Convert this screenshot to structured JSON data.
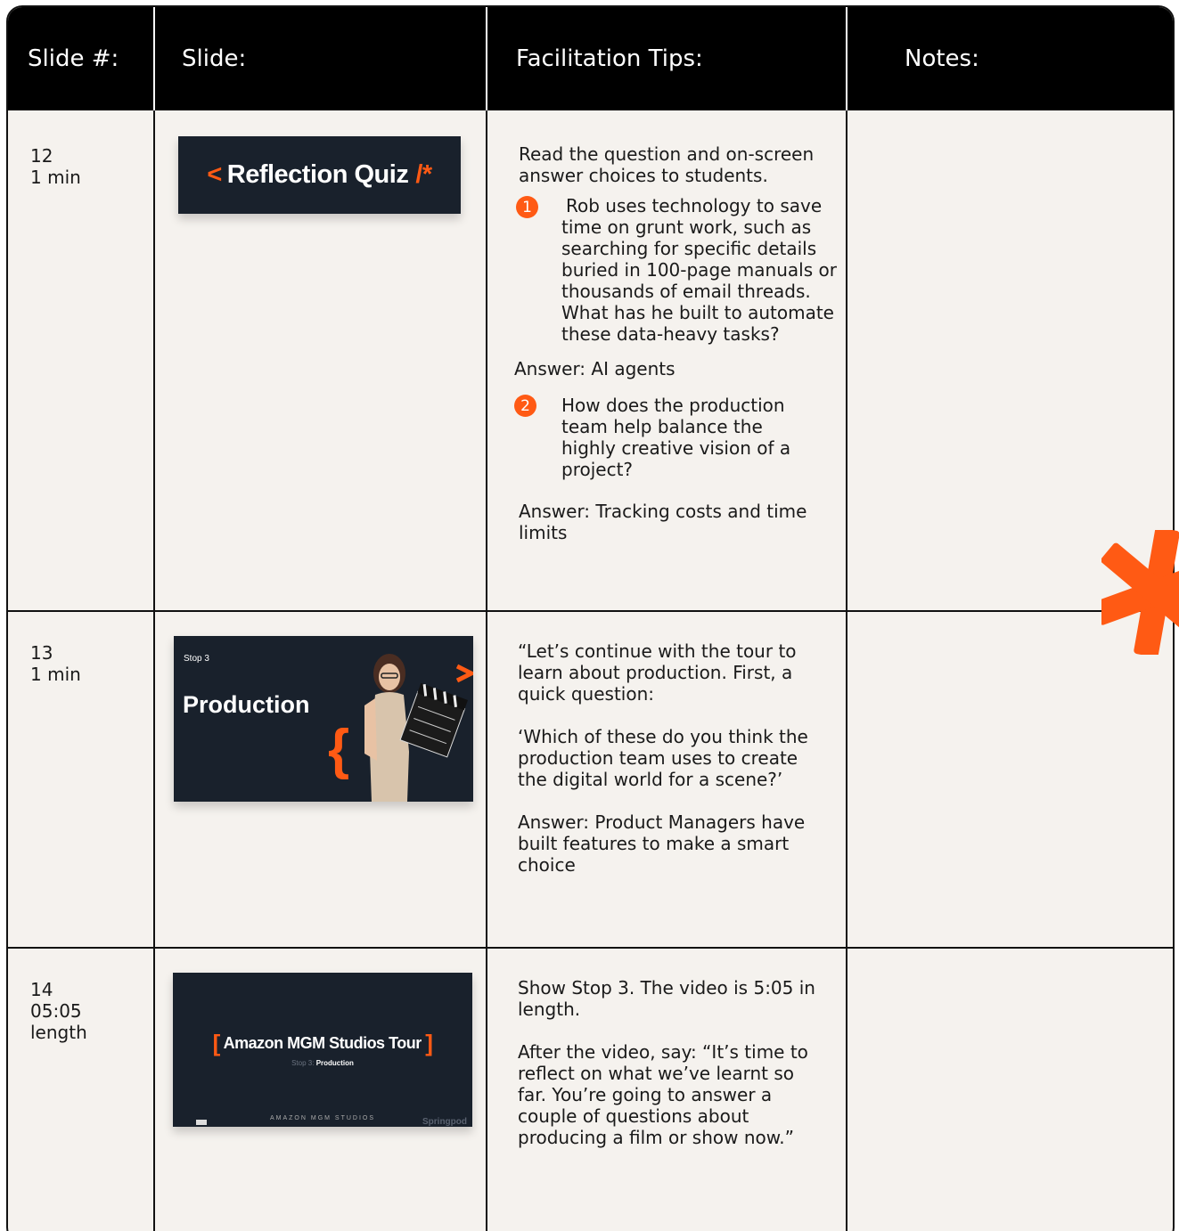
{
  "header": {
    "col_slide_num": "Slide #:",
    "col_slide": "Slide:",
    "col_tips": "Facilitation Tips:",
    "col_notes": "Notes:"
  },
  "rows": [
    {
      "slide_num": "12\n1 min",
      "thumb": {
        "title_left": "<",
        "title_text": "Reflection Quiz",
        "title_right": "/*"
      },
      "tips": {
        "intro": "Read the question and on-screen answer choices to students.",
        "q1_badge": "1",
        "q1": "Rob uses technology to save time on grunt work, such as searching for specific details buried in 100-page manuals or thousands of email threads. What has he built to automate these data-heavy tasks?",
        "a1": "Answer: AI agents",
        "q2_badge": "2",
        "q2": "How does the production team help balance the highly creative vision of a project?",
        "a2": "Answer: Tracking costs and time limits"
      },
      "notes": ""
    },
    {
      "slide_num": "13\n1 min",
      "thumb": {
        "stop": "Stop 3",
        "title": "Production"
      },
      "tips": {
        "p1": "“Let’s continue with the tour to learn about production. First, a quick question:",
        "p2": "‘Which of these do you think the production team uses to create the digital world for a scene?’",
        "p3": "Answer: Product Managers have built features to make a smart choice"
      },
      "notes": ""
    },
    {
      "slide_num": "14\n05:05\nlength",
      "thumb": {
        "title": "Amazon MGM Studios Tour",
        "subtitle_stop": "Stop 3:",
        "subtitle": "Production",
        "footer_brand": "AMAZON MGM STUDIOS",
        "footer_partner": "Springpod"
      },
      "tips": {
        "p1": "Show Stop 3. The video is 5:05 in length.",
        "p2": "After the video, say: “It’s time to reflect on what we’ve learnt so far. You’re going to answer a couple of questions about producing a film or show now.”"
      },
      "notes": ""
    }
  ],
  "colors": {
    "accent": "#ff5a14",
    "header_bg": "#000000",
    "table_bg": "#f5f2ee",
    "slide_bg": "#19212c"
  }
}
